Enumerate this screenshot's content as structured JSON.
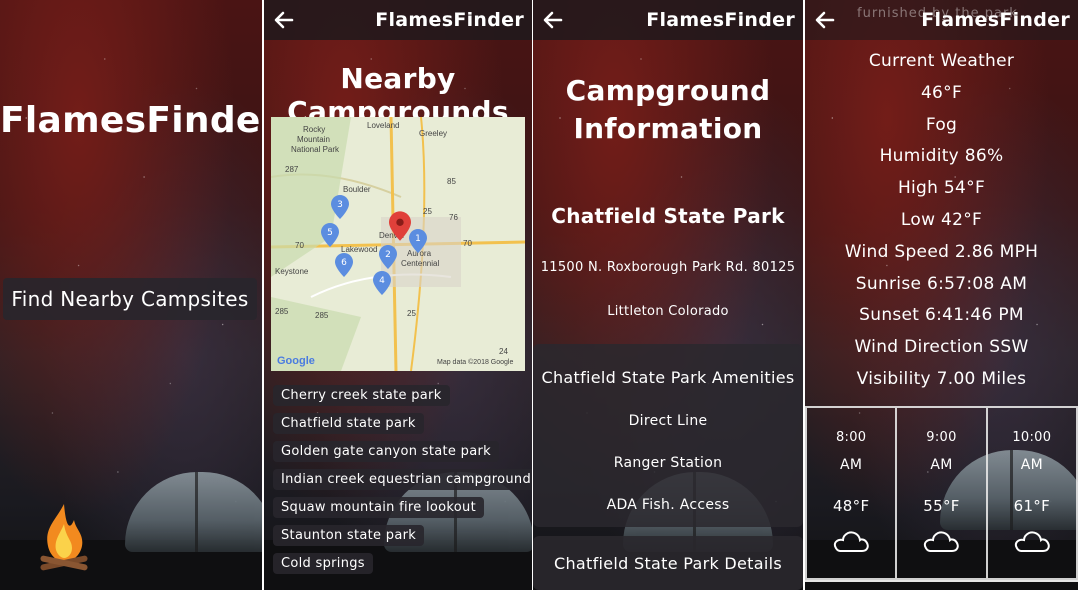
{
  "app": {
    "name": "FlamesFinder"
  },
  "screen1": {
    "title": "FlamesFinder",
    "find_button": "Find Nearby Campsites"
  },
  "screen2": {
    "header_title": "FlamesFinder",
    "heading": "Nearby Campgrounds",
    "map": {
      "labels": [
        "Loveland",
        "Rocky",
        "Mountain",
        "National Park",
        "Greeley",
        "Boulder",
        "Denver",
        "Aurora",
        "Lakewood",
        "Centennial",
        "Keystone",
        "Google",
        "Map data ©2018 Google"
      ],
      "highway_labels": [
        "287",
        "85",
        "25",
        "76",
        "70",
        "70",
        "285",
        "285",
        "25",
        "24"
      ],
      "pins": [
        "1",
        "2",
        "3",
        "4",
        "5",
        "6"
      ]
    },
    "campgrounds": [
      "Cherry creek state park",
      "Chatfield state park",
      "Golden gate canyon state park",
      "Indian creek equestrian campground",
      "Squaw mountain fire lookout",
      "Staunton state park",
      "Cold springs"
    ]
  },
  "screen3": {
    "header_title": "FlamesFinder",
    "heading_line1": "Campground",
    "heading_line2": "Information",
    "park_name": "Chatfield State Park",
    "address": "11500 N. Roxborough Park Rd. 80125",
    "city": "Littleton Colorado",
    "amenities_title": "Chatfield State Park Amenities",
    "amenities": [
      "Direct Line",
      "Ranger Station",
      "ADA Fish. Access"
    ],
    "details_button": "Chatfield State Park Details"
  },
  "screen4": {
    "header_title": "FlamesFinder",
    "watermark": "furnished by the park",
    "weather": {
      "title": "Current Weather",
      "temp": "46°F",
      "condition": "Fog",
      "humidity": "Humidity 86%",
      "high": "High 54°F",
      "low": "Low 42°F",
      "wind_speed": "Wind Speed 2.86 MPH",
      "sunrise": "Sunrise 6:57:08 AM",
      "sunset": "Sunset 6:41:46 PM",
      "wind_direction": "Wind Direction SSW",
      "visibility": "Visibility 7.00 Miles"
    },
    "forecast": [
      {
        "time": "8:00",
        "ampm": "AM",
        "temp": "48°F",
        "icon": "cloud-icon"
      },
      {
        "time": "9:00",
        "ampm": "AM",
        "temp": "55°F",
        "icon": "cloud-icon"
      },
      {
        "time": "10:00",
        "ampm": "AM",
        "temp": "61°F",
        "icon": "cloud-icon"
      }
    ]
  },
  "colors": {
    "panel_red": "#4a1414",
    "button_bg": "#28262c",
    "pin_blue": "#5b8de0",
    "pin_red": "#e0403a",
    "map_bg": "#e8ecd6"
  }
}
